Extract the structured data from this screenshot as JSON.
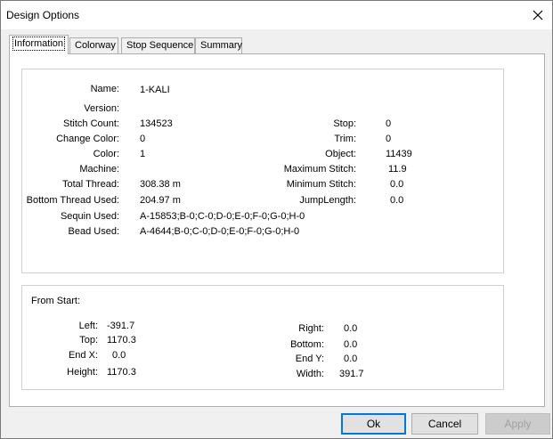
{
  "window": {
    "title": "Design Options"
  },
  "tabs": [
    {
      "label": "Information"
    },
    {
      "label": "Colorway"
    },
    {
      "label": "Stop Sequence"
    },
    {
      "label": "Summary"
    }
  ],
  "info": {
    "name": {
      "label": "Name:",
      "value": "1-KALI"
    },
    "version": {
      "label": "Version:",
      "value": ""
    },
    "stitch_count": {
      "label": "Stitch Count:",
      "value": "134523"
    },
    "change_color": {
      "label": "Change Color:",
      "value": "0"
    },
    "color": {
      "label": "Color:",
      "value": "1"
    },
    "machine": {
      "label": "Machine:",
      "value": ""
    },
    "total_thread": {
      "label": "Total Thread:",
      "value": "308.38 m"
    },
    "bottom_thread": {
      "label": "Bottom Thread Used:",
      "value": "204.97 m"
    },
    "sequin": {
      "label": "Sequin Used:",
      "value": "A-15853;B-0;C-0;D-0;E-0;F-0;G-0;H-0"
    },
    "bead": {
      "label": "Bead Used:",
      "value": "A-4644;B-0;C-0;D-0;E-0;F-0;G-0;H-0"
    },
    "stop": {
      "label": "Stop:",
      "value": "0"
    },
    "trim": {
      "label": "Trim:",
      "value": "0"
    },
    "object": {
      "label": "Object:",
      "value": "11439"
    },
    "max_stitch": {
      "label": "Maximum Stitch:",
      "value": "11.9"
    },
    "min_stitch": {
      "label": "Minimum Stitch:",
      "value": "0.0"
    },
    "jump_length": {
      "label": "JumpLength:",
      "value": "0.0"
    }
  },
  "from_start": {
    "title": "From Start:",
    "left": {
      "label": "Left:",
      "value": "-391.7"
    },
    "top": {
      "label": "Top:",
      "value": "1170.3"
    },
    "end_x": {
      "label": "End X:",
      "value": "0.0"
    },
    "height": {
      "label": "Height:",
      "value": "1170.3"
    },
    "right": {
      "label": "Right:",
      "value": "0.0"
    },
    "bottom": {
      "label": "Bottom:",
      "value": "0.0"
    },
    "end_y": {
      "label": "End Y:",
      "value": "0.0"
    },
    "width": {
      "label": "Width:",
      "value": "391.7"
    }
  },
  "buttons": {
    "ok": "Ok",
    "cancel": "Cancel",
    "apply": "Apply"
  }
}
